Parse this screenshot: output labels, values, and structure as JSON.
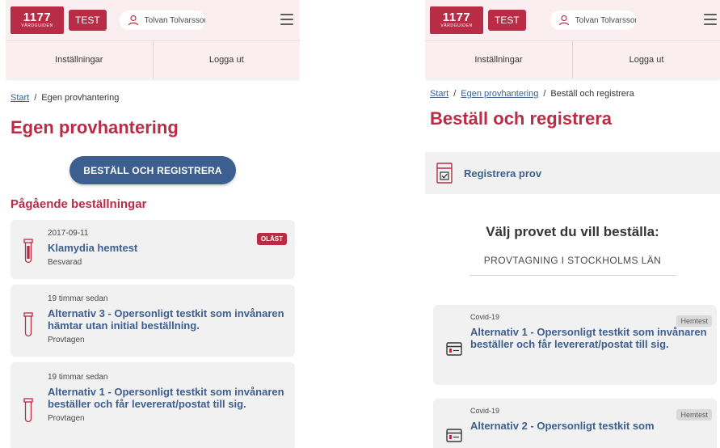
{
  "header": {
    "logo_number": "1177",
    "logo_subtitle": "VÅRDGUIDEN",
    "test_badge": "TEST",
    "user_name": "Tolvan Tolvarsson",
    "menu_icon": "hamburger-icon",
    "user_icon": "user-icon"
  },
  "nav": {
    "settings": "Inställningar",
    "logout": "Logga ut"
  },
  "left": {
    "breadcrumb": {
      "start": "Start",
      "separator": "/",
      "current": "Egen provhantering"
    },
    "title": "Egen provhantering",
    "order_button": "BESTÄLL OCH REGISTRERA",
    "section_heading": "Pågående beställningar",
    "orders": [
      {
        "date": "2017-09-11",
        "title": "Klamydia hemtest",
        "status": "Besvarad",
        "badge": "OLÄST",
        "icon": "test-tube-icon"
      },
      {
        "date": "19 timmar sedan",
        "title": "Alternativ 3 - Opersonligt testkit som invånaren hämtar utan initial beställning.",
        "status": "Provtagen",
        "icon": "test-tube-icon"
      },
      {
        "date": "19 timmar sedan",
        "title": "Alternativ 1 - Opersonligt testkit som invånaren beställer och får levererat/postat till sig.",
        "status": "Provtagen",
        "icon": "test-tube-icon"
      }
    ]
  },
  "right": {
    "breadcrumb": {
      "start": "Start",
      "separator": "/",
      "middle": "Egen provhantering",
      "current": "Beställ och registrera"
    },
    "title": "Beställ och registrera",
    "register_label": "Registrera prov",
    "register_icon": "checklist-document-icon",
    "choose_heading": "Välj provet du vill beställa:",
    "region": "PROVTAGNING I STOCKHOLMS LÄN",
    "tests": [
      {
        "category": "Covid-19",
        "badge": "Hemtest",
        "title": "Alternativ 1 - Opersonligt testkit som invånaren beställer och får levererat/postat till sig.",
        "icon": "test-kit-icon"
      },
      {
        "category": "Covid-19",
        "badge": "Hemtest",
        "title": "Alternativ 2 - Opersonligt testkit som",
        "icon": "test-kit-icon"
      }
    ]
  },
  "colors": {
    "brand": "#b92c46",
    "link": "#396291",
    "button": "#3d5f8f",
    "header_bg": "#fbeef0",
    "card_bg": "#f1f1f1"
  }
}
